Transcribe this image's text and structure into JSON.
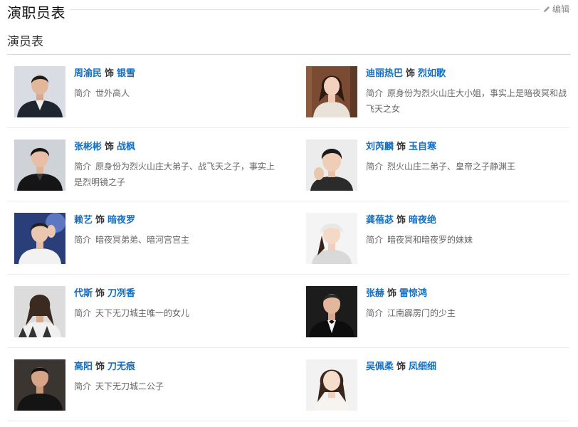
{
  "section": {
    "title": "演职员表",
    "edit_label": "编辑",
    "subtitle": "演员表"
  },
  "accent_color": "#136ec2",
  "as_word": "饰",
  "desc_label": "简介",
  "cast": [
    {
      "actor": "周渝民",
      "role": "银雪",
      "desc": "世外高人"
    },
    {
      "actor": "迪丽热巴",
      "role": "烈如歌",
      "desc": "原身份为烈火山庄大小姐，事实上是暗夜冥和战飞天之女"
    },
    {
      "actor": "张彬彬",
      "role": "战枫",
      "desc": "原身份为烈火山庄大弟子、战飞天之子，事实上是烈明镜之子"
    },
    {
      "actor": "刘芮麟",
      "role": "玉自寒",
      "desc": "烈火山庄二弟子、皇帝之子静渊王"
    },
    {
      "actor": "赖艺",
      "role": "暗夜罗",
      "desc": "暗夜冥弟弟、暗河宫宫主"
    },
    {
      "actor": "龚蓓苾",
      "role": "暗夜绝",
      "desc": "暗夜冥和暗夜罗的妹妹"
    },
    {
      "actor": "代斯",
      "role": "刀冽香",
      "desc": "天下无刀城主唯一的女儿"
    },
    {
      "actor": "张赫",
      "role": "雷惊鸿",
      "desc": "江南霹雳门的少主"
    },
    {
      "actor": "高阳",
      "role": "刀无痕",
      "desc": "天下无刀城二公子"
    },
    {
      "actor": "吴佩柔",
      "role": "凤细细",
      "desc": ""
    }
  ]
}
